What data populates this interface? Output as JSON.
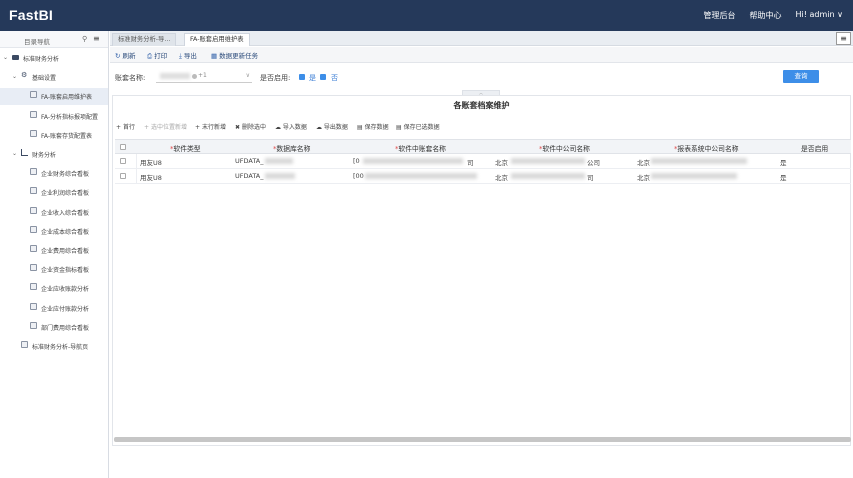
{
  "app": {
    "logo": "FastBI",
    "nav": [
      "管理后台",
      "帮助中心"
    ],
    "user_greeting": "Hi!",
    "user_name": "admin"
  },
  "sidebar": {
    "header": "目录导航",
    "items": [
      {
        "label": "标准财务分析",
        "level": 0,
        "icon": "folder-icon",
        "expanded": true
      },
      {
        "label": "基础设置",
        "level": 1,
        "icon": "gear-icon",
        "expanded": true
      },
      {
        "label": "FA-账套启用维护表",
        "level": 2,
        "icon": "document-icon",
        "active": true
      },
      {
        "label": "FA-分析指标报项配置",
        "level": 2,
        "icon": "document-icon"
      },
      {
        "label": "FA-账套存货配置表",
        "level": 2,
        "icon": "document-icon"
      },
      {
        "label": "财务分析",
        "level": 1,
        "icon": "chart-icon",
        "expanded": true
      },
      {
        "label": "企业财务综合看板",
        "level": 2,
        "icon": "document-icon"
      },
      {
        "label": "企业利润综合看板",
        "level": 2,
        "icon": "document-icon"
      },
      {
        "label": "企业收入综合看板",
        "level": 2,
        "icon": "document-icon"
      },
      {
        "label": "企业成本综合看板",
        "level": 2,
        "icon": "document-icon"
      },
      {
        "label": "企业费用综合看板",
        "level": 2,
        "icon": "document-icon"
      },
      {
        "label": "企业资金指标看板",
        "level": 2,
        "icon": "document-icon"
      },
      {
        "label": "企业应收账款分析",
        "level": 2,
        "icon": "document-icon"
      },
      {
        "label": "企业应付账款分析",
        "level": 2,
        "icon": "document-icon"
      },
      {
        "label": "部门费用综合看板",
        "level": 2,
        "icon": "document-icon"
      },
      {
        "label": "标准财务分析-导航页",
        "level": 1,
        "icon": "document-icon"
      }
    ]
  },
  "tabs": [
    {
      "label": "标准财务分析-导...",
      "active": false
    },
    {
      "label": "FA-账套启用维护表",
      "active": true
    }
  ],
  "toolbar": {
    "refresh": "刷新",
    "print": "打印",
    "export": "导出",
    "update_task": "数据更新任务"
  },
  "filter": {
    "account_label": "账套名称:",
    "account_value_tag": "+1",
    "enabled_label": "是否启用:",
    "yes": "是",
    "no": "否",
    "query": "查询"
  },
  "panel": {
    "title": "各账套档案维护",
    "actions": [
      "首行",
      "选中位置新增",
      "末行新增",
      "删除选中",
      "导入数据",
      "导出数据",
      "保存数据",
      "保存已选数据"
    ],
    "columns": [
      "软件类型",
      "数据库名称",
      "软件中账套名称",
      "软件中公司名称",
      "报表系统中公司名称",
      "是否启用"
    ],
    "rows": [
      {
        "software": "用友U8",
        "db": "UFDATA_",
        "book": "[0",
        "book_tail": "司",
        "company": "北京",
        "company_tail": "公司",
        "report_company": "北京",
        "enabled": "是"
      },
      {
        "software": "用友U8",
        "db": "UFDATA_",
        "book": "[00",
        "book_tail": "",
        "company": "北京",
        "company_tail": "司",
        "report_company": "北京",
        "enabled": "是"
      }
    ]
  }
}
